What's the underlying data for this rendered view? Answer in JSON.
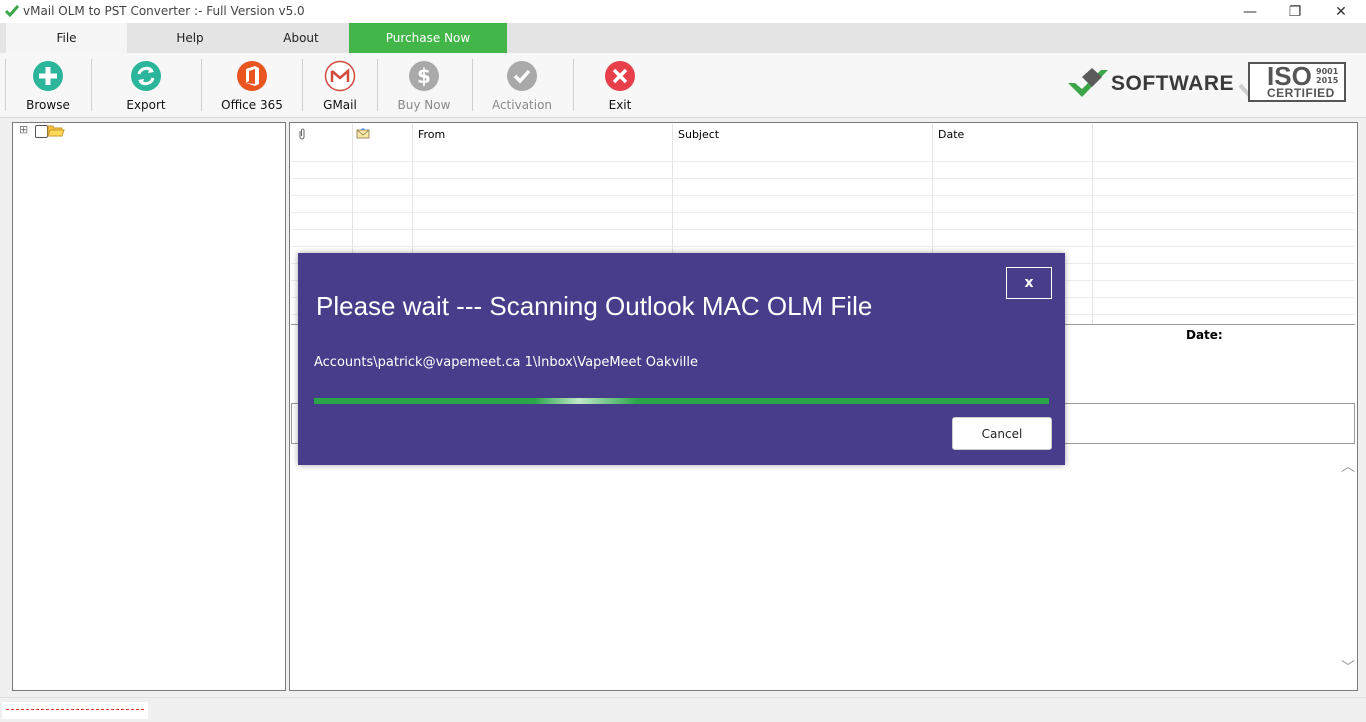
{
  "window": {
    "title": "vMail OLM to PST Converter :- Full Version v5.0",
    "minimize_glyph": "—",
    "restore_glyph": "❐",
    "close_glyph": "✕"
  },
  "menu": {
    "file": "File",
    "help": "Help",
    "about": "About",
    "purchase": "Purchase Now"
  },
  "toolbar": {
    "browse": "Browse",
    "export": "Export",
    "office365": "Office 365",
    "gmail": "GMail",
    "buynow": "Buy Now",
    "activation": "Activation",
    "exit": "Exit"
  },
  "brand": {
    "software": "SOFTWARE",
    "iso": "ISO",
    "iso_numbers_1": "9001",
    "iso_numbers_2": "2015",
    "certified": "CERTIFIED"
  },
  "tree": {
    "expand_glyph": "⊞"
  },
  "grid": {
    "columns": [
      "",
      "",
      "From",
      "Subject",
      "Date"
    ]
  },
  "preview": {
    "date_label": "Date:",
    "scroll_up_glyph": "︿",
    "scroll_down_glyph": "﹀"
  },
  "dialog": {
    "title": "Please wait --- Scanning Outlook MAC OLM File",
    "close": "x",
    "path": "Accounts\\patrick@vapemeet.ca 1\\Inbox\\VapeMeet Oakville",
    "progress": 1.0,
    "cancel": "Cancel"
  },
  "colors": {
    "purchase_bg": "#43b649",
    "dialog_bg": "#483d8b",
    "progress": "#2ea84a"
  }
}
